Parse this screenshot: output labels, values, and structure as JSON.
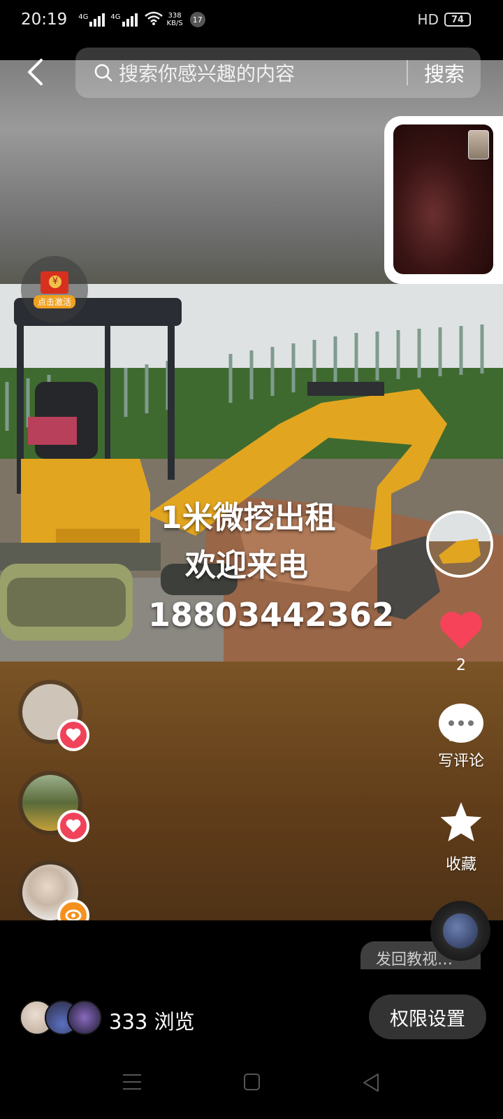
{
  "status_bar": {
    "time": "20:19",
    "signal_1_label": "4G",
    "signal_2_label": "4G",
    "net_speed_value": "338",
    "net_speed_unit": "KB/S",
    "notification_count": "17",
    "hd_label": "HD",
    "battery": "74"
  },
  "search": {
    "placeholder": "搜索你感兴趣的内容",
    "button_label": "搜索"
  },
  "red_packet": {
    "label": "点击激活"
  },
  "post": {
    "overlay_line1": "1米微挖出租",
    "overlay_line2": "欢迎来电",
    "overlay_line3": "18803442362"
  },
  "actions": {
    "like_count": "2",
    "comment_label": "写评论",
    "favorite_label": "收藏"
  },
  "left_avatars": [
    {
      "badge": "heart-icon",
      "badge_color": "#f0435a"
    },
    {
      "badge": "heart-icon",
      "badge_color": "#f0435a"
    },
    {
      "badge": "eye-icon",
      "badge_color": "#f5901e"
    }
  ],
  "music_pill_text": "发回教视…",
  "footer": {
    "view_count": "333 浏览",
    "permission_button": "权限设置"
  },
  "colors": {
    "like_heart": "#f7435a",
    "accent_orange": "#f5901e",
    "red_packet": "#d8301f"
  }
}
